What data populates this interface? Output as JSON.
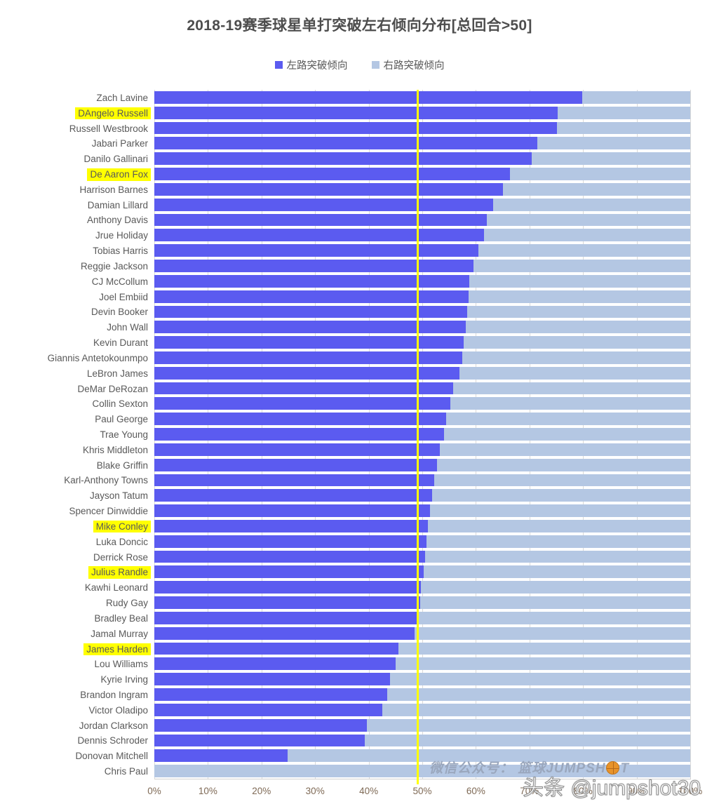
{
  "header": {
    "title": "2018-19赛季球星单打突破左右倾向分布[总回合>50]"
  },
  "legend": {
    "items": [
      {
        "label": "左路突破倾向",
        "color": "#5b5bf0"
      },
      {
        "label": "右路突破倾向",
        "color": "#b4c7e3"
      }
    ]
  },
  "watermarks": {
    "wechat_prefix": "微信公众号： 篮球JUMPSH",
    "wechat_suffix": "T",
    "toutiao": "头条 @jumpshot30"
  },
  "axis": {
    "x_ticks": [
      "0%",
      "10%",
      "20%",
      "30%",
      "40%",
      "50%",
      "60%",
      "70%",
      "80%",
      "90%",
      "100%"
    ],
    "mid_marker_value": 50,
    "mid_marker_color": "#ffff00",
    "highlight_color": "#ffff00"
  },
  "chart_data": {
    "type": "bar",
    "orientation": "horizontal",
    "stacked": true,
    "title": "2018-19赛季球星单打突破左右倾向分布[总回合>50]",
    "xlabel": "",
    "ylabel": "",
    "xlim": [
      0,
      100
    ],
    "xtick_step": 10,
    "grid": true,
    "legend_position": "top-center",
    "series": [
      {
        "name": "左路突破倾向",
        "color": "#5b5bf0",
        "values": [
          79.8,
          75.3,
          75.1,
          71.5,
          70.4,
          66.3,
          65.0,
          63.2,
          62.0,
          61.5,
          60.5,
          59.6,
          58.8,
          58.6,
          58.4,
          58.1,
          57.7,
          57.4,
          56.9,
          55.8,
          55.3,
          54.4,
          54.0,
          53.3,
          52.8,
          52.2,
          51.8,
          51.4,
          51.1,
          50.8,
          50.5,
          50.2,
          49.8,
          49.6,
          48.9,
          48.6,
          45.6,
          45.0,
          44.0,
          43.5,
          42.5,
          39.7,
          39.3,
          24.9
        ]
      },
      {
        "name": "右路突破倾向",
        "color": "#b4c7e3",
        "values": [
          20.2,
          24.7,
          24.9,
          28.5,
          29.6,
          33.7,
          35.0,
          36.8,
          38.0,
          38.5,
          39.5,
          40.4,
          41.2,
          41.4,
          41.6,
          41.9,
          42.3,
          42.6,
          43.1,
          44.2,
          44.7,
          45.6,
          46.0,
          46.7,
          47.2,
          47.8,
          48.2,
          48.6,
          48.9,
          49.2,
          49.5,
          49.8,
          50.2,
          50.4,
          51.1,
          51.4,
          54.4,
          55.0,
          56.0,
          56.5,
          57.5,
          60.3,
          60.7,
          75.1
        ]
      }
    ],
    "categories": [
      "Zach Lavine",
      "DAngelo Russell",
      "Russell Westbrook",
      "Jabari Parker",
      "Danilo Gallinari",
      "De Aaron Fox",
      "Harrison Barnes",
      "Damian Lillard",
      "Anthony Davis",
      "Jrue Holiday",
      "Tobias Harris",
      "Reggie Jackson",
      "CJ McCollum",
      "Joel Embiid",
      "Devin Booker",
      "John Wall",
      "Kevin Durant",
      "Giannis Antetokounmpo",
      "LeBron James",
      "DeMar DeRozan",
      "Collin Sexton",
      "Paul George",
      "Trae Young",
      "Khris Middleton",
      "Blake Griffin",
      "Karl-Anthony Towns",
      "Jayson Tatum",
      "Spencer Dinwiddie",
      "Mike Conley",
      "Luka Doncic",
      "Derrick Rose",
      "Julius Randle",
      "Kawhi Leonard",
      "Rudy Gay",
      "Bradley Beal",
      "Jamal Murray",
      "James Harden",
      "Lou Williams",
      "Kyrie Irving",
      "Brandon Ingram",
      "Victor Oladipo",
      "Jordan Clarkson",
      "Dennis Schroder",
      "Donovan Mitchell",
      "Chris Paul"
    ],
    "highlighted_categories": [
      "DAngelo Russell",
      "De Aaron Fox",
      "Mike Conley",
      "Julius Randle",
      "James Harden"
    ]
  }
}
